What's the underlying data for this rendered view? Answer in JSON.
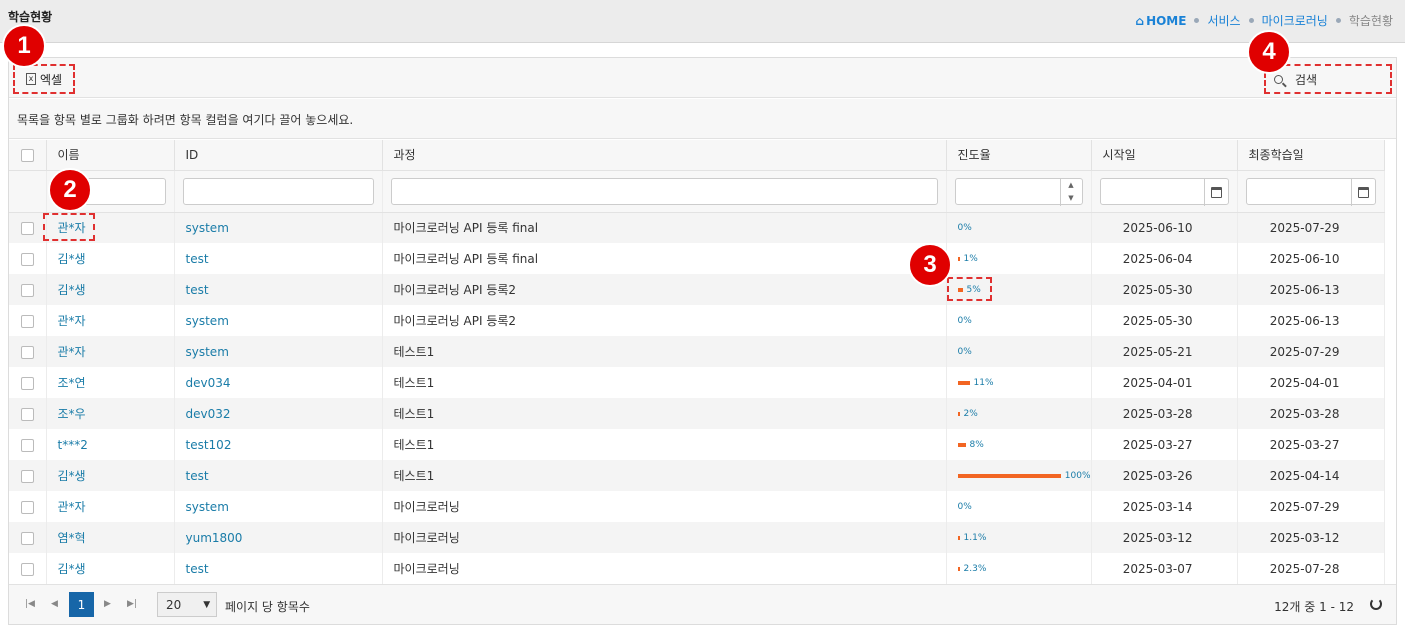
{
  "header": {
    "title": "학습현황",
    "breadcrumb": {
      "home": "HOME",
      "items": [
        "서비스",
        "마이크로러닝"
      ],
      "current": "학습현황"
    }
  },
  "toolbar": {
    "excel_label": "엑셀",
    "search_placeholder": "검색"
  },
  "group_hint": "목록을 항목 별로 그룹화 하려면 항목 컬럼을 여기다 끌어 놓으세요.",
  "columns": [
    "이름",
    "ID",
    "과정",
    "진도율",
    "시작일",
    "최종학습일"
  ],
  "rows": [
    {
      "name": "관*자",
      "id": "system",
      "course": "마이크로러닝 API 등록 final",
      "progress": 0,
      "progress_label": "0%",
      "start": "2025-06-10",
      "last": "2025-07-29"
    },
    {
      "name": "김*생",
      "id": "test",
      "course": "마이크로러닝 API 등록 final",
      "progress": 1,
      "progress_label": "1%",
      "start": "2025-06-04",
      "last": "2025-06-10"
    },
    {
      "name": "김*생",
      "id": "test",
      "course": "마이크로러닝 API 등록2",
      "progress": 5,
      "progress_label": "5%",
      "start": "2025-05-30",
      "last": "2025-06-13"
    },
    {
      "name": "관*자",
      "id": "system",
      "course": "마이크로러닝 API 등록2",
      "progress": 0,
      "progress_label": "0%",
      "start": "2025-05-30",
      "last": "2025-06-13"
    },
    {
      "name": "관*자",
      "id": "system",
      "course": "테스트1",
      "progress": 0,
      "progress_label": "0%",
      "start": "2025-05-21",
      "last": "2025-07-29"
    },
    {
      "name": "조*연",
      "id": "dev034",
      "course": "테스트1",
      "progress": 11,
      "progress_label": "11%",
      "start": "2025-04-01",
      "last": "2025-04-01"
    },
    {
      "name": "조*우",
      "id": "dev032",
      "course": "테스트1",
      "progress": 2,
      "progress_label": "2%",
      "start": "2025-03-28",
      "last": "2025-03-28"
    },
    {
      "name": "t***2",
      "id": "test102",
      "course": "테스트1",
      "progress": 8,
      "progress_label": "8%",
      "start": "2025-03-27",
      "last": "2025-03-27"
    },
    {
      "name": "김*생",
      "id": "test",
      "course": "테스트1",
      "progress": 100,
      "progress_label": "100%",
      "start": "2025-03-26",
      "last": "2025-04-14"
    },
    {
      "name": "관*자",
      "id": "system",
      "course": "마이크로러닝",
      "progress": 0,
      "progress_label": "0%",
      "start": "2025-03-14",
      "last": "2025-07-29"
    },
    {
      "name": "염*혁",
      "id": "yum1800",
      "course": "마이크로러닝",
      "progress": 1.1,
      "progress_label": "1.1%",
      "start": "2025-03-12",
      "last": "2025-03-12"
    },
    {
      "name": "김*생",
      "id": "test",
      "course": "마이크로러닝",
      "progress": 2.3,
      "progress_label": "2.3%",
      "start": "2025-03-07",
      "last": "2025-07-28"
    }
  ],
  "pager": {
    "current_page": "1",
    "page_size": "20",
    "page_size_label": "페이지 당 항목수",
    "info": "12개 중 1 - 12"
  },
  "annotations": [
    "1",
    "2",
    "3",
    "4"
  ],
  "colors": {
    "accent": "#1a82d6",
    "progress_bar": "#f26522",
    "annotation": "#e00000"
  }
}
